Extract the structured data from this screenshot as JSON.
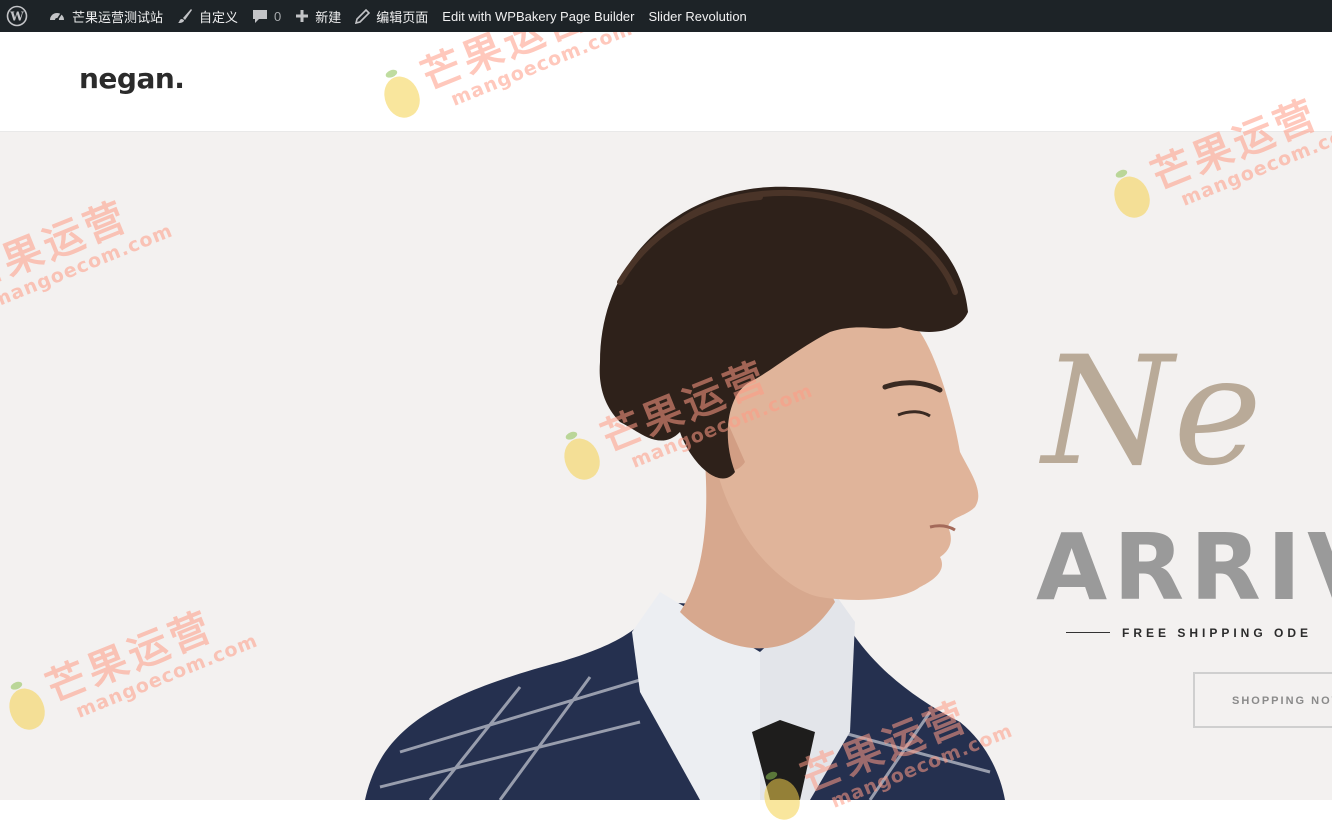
{
  "admin_bar": {
    "site_name": "芒果运营测试站",
    "customize": "自定义",
    "comments_count": "0",
    "new": "新建",
    "edit_page": "编辑页面",
    "edit_wpbakery": "Edit with WPBakery Page Builder",
    "slider_revolution": "Slider Revolution",
    "icons": {
      "wp": "wordpress-icon",
      "site": "dashboard-icon",
      "customize": "brush-icon",
      "comments": "comment-icon",
      "new": "plus-icon",
      "edit": "pencil-icon"
    },
    "background": "#1d2327"
  },
  "header": {
    "logo": "negan."
  },
  "hero": {
    "script_title": "Ne",
    "headline": "ARRIV",
    "subtitle": "FREE SHIPPING ODE",
    "cta": "SHOPPING NOW",
    "background": "#f3f1f0",
    "script_color": "#b9aa98",
    "headline_color": "#9a9a9a"
  },
  "watermark": {
    "cn": "芒果运营",
    "en": "mangoecom.com"
  }
}
